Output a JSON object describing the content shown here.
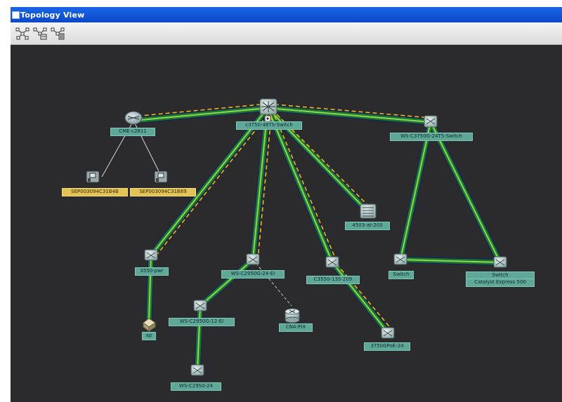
{
  "window": {
    "title": "Topology View"
  },
  "toolbar": {
    "buttons": [
      {
        "icon": "topology-layout-icon"
      },
      {
        "icon": "topology-refresh-icon"
      },
      {
        "icon": "topology-filter-icon"
      }
    ]
  },
  "topology": {
    "devices": [
      {
        "name": "c3750-48TS-Switch",
        "type": "core-switch"
      },
      {
        "name": "CME-c2811",
        "type": "router"
      },
      {
        "name": "WS-C3750G-24TS-Switch",
        "type": "switch"
      },
      {
        "name": "SEP003094C31B4B",
        "type": "ip-phone"
      },
      {
        "name": "SEP003094C31B89",
        "type": "ip-phone"
      },
      {
        "name": "4503-at-203",
        "type": "chassis-switch"
      },
      {
        "name": "3550-pwr",
        "type": "switch"
      },
      {
        "name": "WS-C2950G-24-EI",
        "type": "switch"
      },
      {
        "name": "C3550-13S-209",
        "type": "switch"
      },
      {
        "name": "Switch",
        "type": "switch"
      },
      {
        "name": "Switch",
        "subtitle": "Catalyst Express 500",
        "type": "switch"
      },
      {
        "name": "ap",
        "type": "access-point"
      },
      {
        "name": "WS-C2950G-12-EI",
        "type": "switch"
      },
      {
        "name": "CNA-PIX",
        "type": "firewall"
      },
      {
        "name": "3750GPoE-24",
        "type": "switch"
      },
      {
        "name": "WS-C2950-24",
        "type": "switch"
      }
    ]
  }
}
